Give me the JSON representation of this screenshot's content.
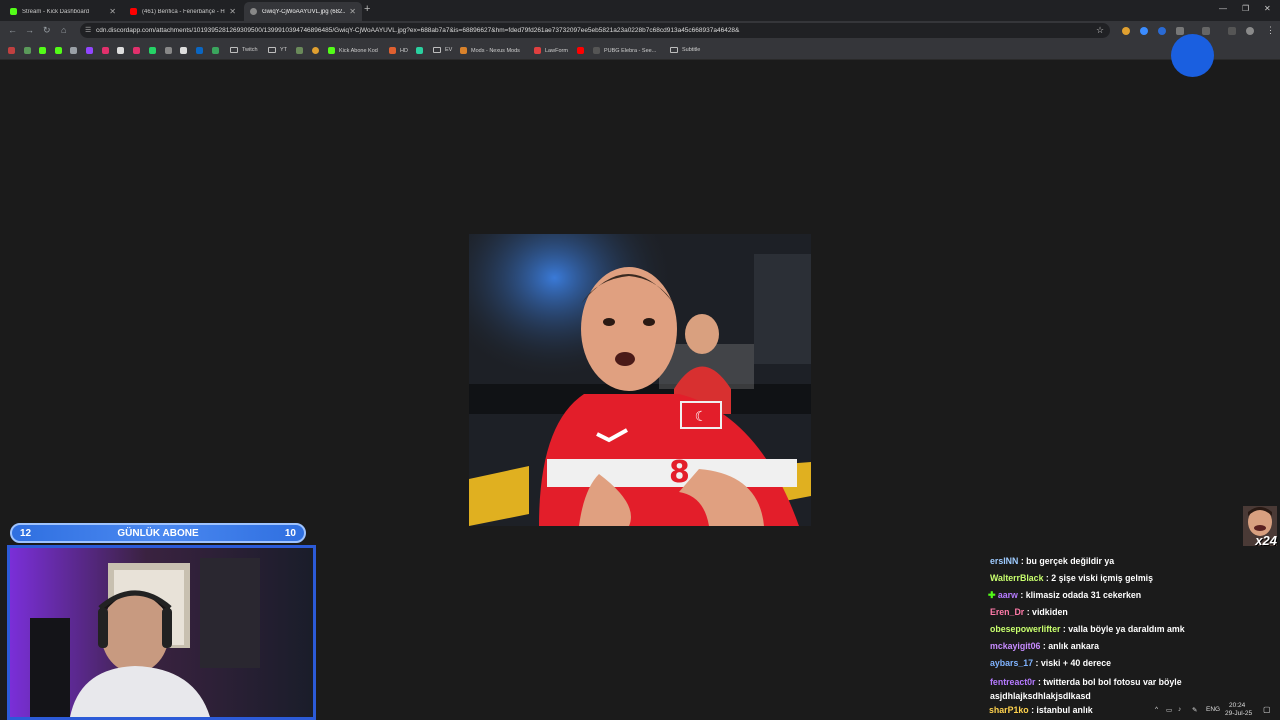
{
  "tabs": [
    {
      "title": "Stream - Kick Dashboard",
      "icon": "kick-icon",
      "color": "#53fc18"
    },
    {
      "title": "(461) Benfica - Fenerbahçe - Hi...",
      "icon": "youtube-icon",
      "color": "#ff0000"
    },
    {
      "title": "GwiqY-CjWoAAYUVL.jpg (682...",
      "icon": "image-icon",
      "color": "#888888",
      "active": true
    }
  ],
  "address_bar": {
    "url": "cdn.discordapp.com/attachments/1019395281269309500/1399910394746896485/GwiqY-CjWoAAYUVL.jpg?ex=688ab7a7&is=68896627&hm=fded79fd261ae73732097ee5eb5821a23a0228b7c68cd913a45c668937a46428&"
  },
  "bookmarks": [
    {
      "label": "Twitch",
      "type": "folder"
    },
    {
      "label": "YT",
      "type": "folder"
    },
    {
      "label": "Kick Abone Kod",
      "type": "link",
      "color": "#53fc18"
    },
    {
      "label": "HD",
      "type": "link",
      "color": "#e06030"
    },
    {
      "label": "EV",
      "type": "folder"
    },
    {
      "label": "Mods - Nexus Mods",
      "type": "link",
      "color": "#d9822b"
    },
    {
      "label": "LawForm",
      "type": "link",
      "color": "#e04040"
    },
    {
      "label": "PUBG Elebra - See...",
      "type": "link",
      "color": "#ff0000"
    },
    {
      "label": "Subtitle",
      "type": "folder"
    }
  ],
  "overlay": {
    "subgoal_left": "12",
    "subgoal_label": "GÜNLÜK ABONE",
    "subgoal_right": "10",
    "emote_count": "x24"
  },
  "chat": [
    {
      "user": "ersINN",
      "color": "#9ecbff",
      "text": ": bu gerçek değildir ya"
    },
    {
      "user": "WalterrBlack",
      "color": "#c8ff6e",
      "text": ": 2 şişe viski içmiş gelmiş"
    },
    {
      "user": "aarw",
      "color": "#b57aff",
      "text": ": klimasiz odada 31 cekerken",
      "badge": "✚"
    },
    {
      "user": "Eren_Dr",
      "color": "#ff7aa8",
      "text": ": vidkiden"
    },
    {
      "user": "obesepowerlifter",
      "color": "#c8ff6e",
      "text": ": valla böyle ya daraldım amk"
    },
    {
      "user": "mckayigit06",
      "color": "#c78bff",
      "text": ": anlık ankara"
    },
    {
      "user": "aybars_17",
      "color": "#7fb3ff",
      "text": ": viski + 40 derece"
    },
    {
      "user": "fentreact0r",
      "color": "#b57aff",
      "text": ": twitterda bol bol fotosu var böyle asjdhlajksdhlakjsdlkasd"
    },
    {
      "user": "sharP1ko",
      "color": "#ffd24d",
      "text": ": istanbul anlık"
    }
  ],
  "system_tray": {
    "language": "ENG",
    "time": "20:24",
    "date": "29-Jul-25"
  }
}
